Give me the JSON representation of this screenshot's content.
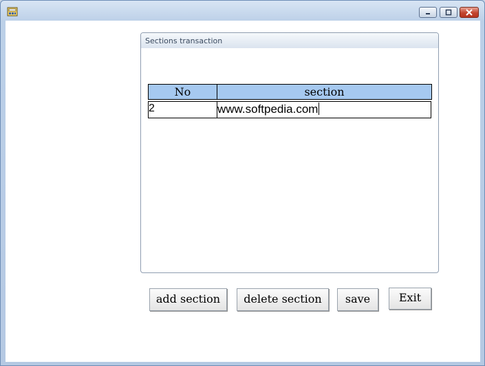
{
  "window": {
    "title": "",
    "icon": "app-icon"
  },
  "controls": {
    "minimize": "minimize-icon",
    "maximize": "maximize-icon",
    "close": "close-icon"
  },
  "group": {
    "title": "Sections transaction"
  },
  "grid": {
    "headers": [
      "No",
      "section"
    ],
    "rows": [
      {
        "no": "2",
        "section": "www.softpedia.com"
      }
    ]
  },
  "buttons": {
    "add": "add section",
    "delete": "delete section",
    "save": "save",
    "exit": "Exit"
  },
  "colors": {
    "header_bg": "#a6c9f0",
    "close_red": "#c2452f"
  }
}
